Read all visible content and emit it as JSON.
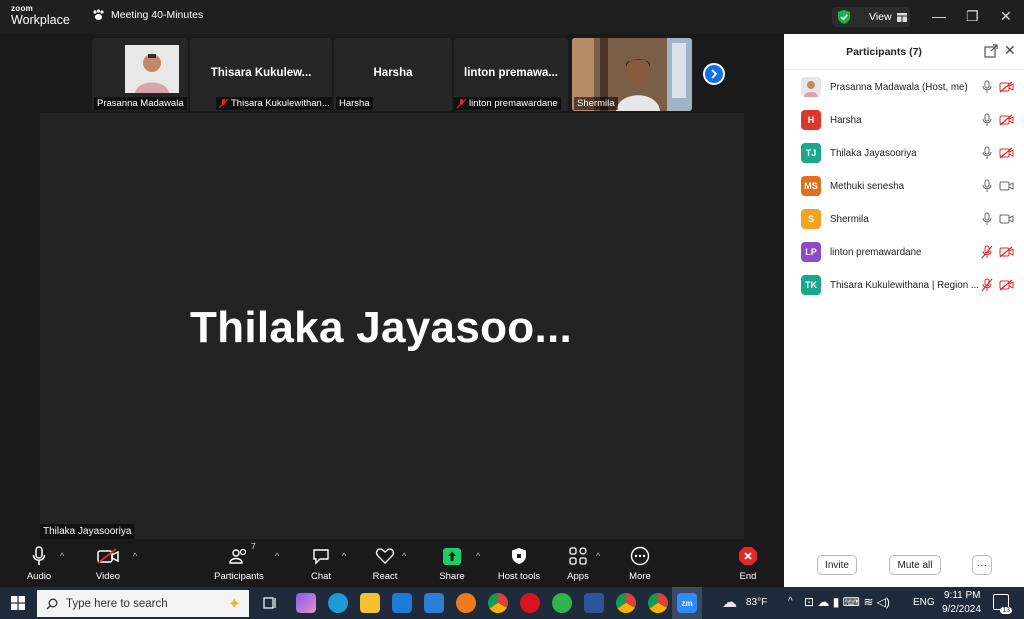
{
  "app": {
    "logo_top": "zoom",
    "logo_bottom": "Workplace",
    "meeting_title": "Meeting 40-Minutes",
    "view_label": "View"
  },
  "thumbnails": [
    {
      "label": "Prasanna Madawala",
      "big_name": "",
      "muted": false
    },
    {
      "label": "Thisara Kukulewithan...",
      "big_name": "Thisara  Kukulew...",
      "muted": true
    },
    {
      "label": "Harsha",
      "big_name": "Harsha",
      "muted": false
    },
    {
      "label": "linton premawardane",
      "big_name": "linton  premawa...",
      "muted": true
    },
    {
      "label": "Shermila",
      "big_name": "",
      "muted": false
    }
  ],
  "main_video": {
    "big_name": "Thilaka  Jayasoo...",
    "label": "Thilaka Jayasooriya"
  },
  "toolbar": {
    "audio": "Audio",
    "video": "Video",
    "participants": "Participants",
    "participants_count": "7",
    "chat": "Chat",
    "react": "React",
    "share": "Share",
    "host_tools": "Host tools",
    "apps": "Apps",
    "more": "More",
    "end": "End"
  },
  "panel": {
    "title": "Participants (7)",
    "invite": "Invite",
    "mute_all": "Mute all",
    "more": "···",
    "participants": [
      {
        "initials": "",
        "name": "Prasanna Madawala (Host, me)",
        "color": "#d9d9d9",
        "mic": "on",
        "cam": "off"
      },
      {
        "initials": "H",
        "name": "Harsha",
        "color": "#d9382f",
        "mic": "on",
        "cam": "off"
      },
      {
        "initials": "TJ",
        "name": "Thilaka Jayasooriya",
        "color": "#1aa88c",
        "mic": "on",
        "cam": "off"
      },
      {
        "initials": "MS",
        "name": "Methuki senesha",
        "color": "#e0701c",
        "mic": "on",
        "cam": "on"
      },
      {
        "initials": "S",
        "name": "Shermila",
        "color": "#f2a322",
        "mic": "on",
        "cam": "on"
      },
      {
        "initials": "LP",
        "name": "linton premawardane",
        "color": "#8d4cc4",
        "mic": "off",
        "cam": "off"
      },
      {
        "initials": "TK",
        "name": "Thisara Kukulewithana | Region ...",
        "color": "#1aa88c",
        "mic": "off",
        "cam": "off"
      }
    ]
  },
  "taskbar": {
    "search_placeholder": "Type here to search",
    "weather": "83°F",
    "lang": "ENG",
    "time": "9:11 PM",
    "date": "9/2/2024",
    "notifications": "13"
  },
  "colors": {
    "accent": "#0e71eb",
    "end_red": "#e02828",
    "share_green": "#1bd06b",
    "muted_red": "#e02828"
  }
}
